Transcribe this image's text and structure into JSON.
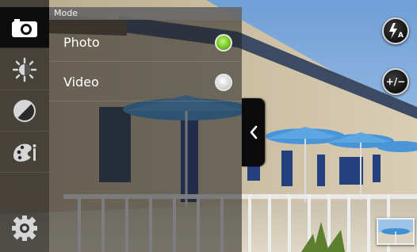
{
  "mode_panel": {
    "header": "Mode",
    "options": [
      {
        "label": "Photo",
        "selected": true
      },
      {
        "label": "Video",
        "selected": false
      }
    ]
  },
  "rail": {
    "items": [
      {
        "icon": "camera-icon",
        "active": true
      },
      {
        "icon": "brightness-icon",
        "active": false
      },
      {
        "icon": "contrast-icon",
        "active": false
      },
      {
        "icon": "color-effect-icon",
        "active": false
      },
      {
        "icon": "settings-gear-icon",
        "active": false
      }
    ]
  },
  "controls": {
    "flash_label": "A",
    "exposure_label": "+/−",
    "collapse_icon": "chevron-left-icon",
    "gallery_icon": "gallery-thumbnail"
  },
  "colors": {
    "radio_selected": "#7fd12c",
    "radio_unselected": "#d6d6d6",
    "sky": "#8fb9e6",
    "umbrella": "#3f8fd6"
  }
}
